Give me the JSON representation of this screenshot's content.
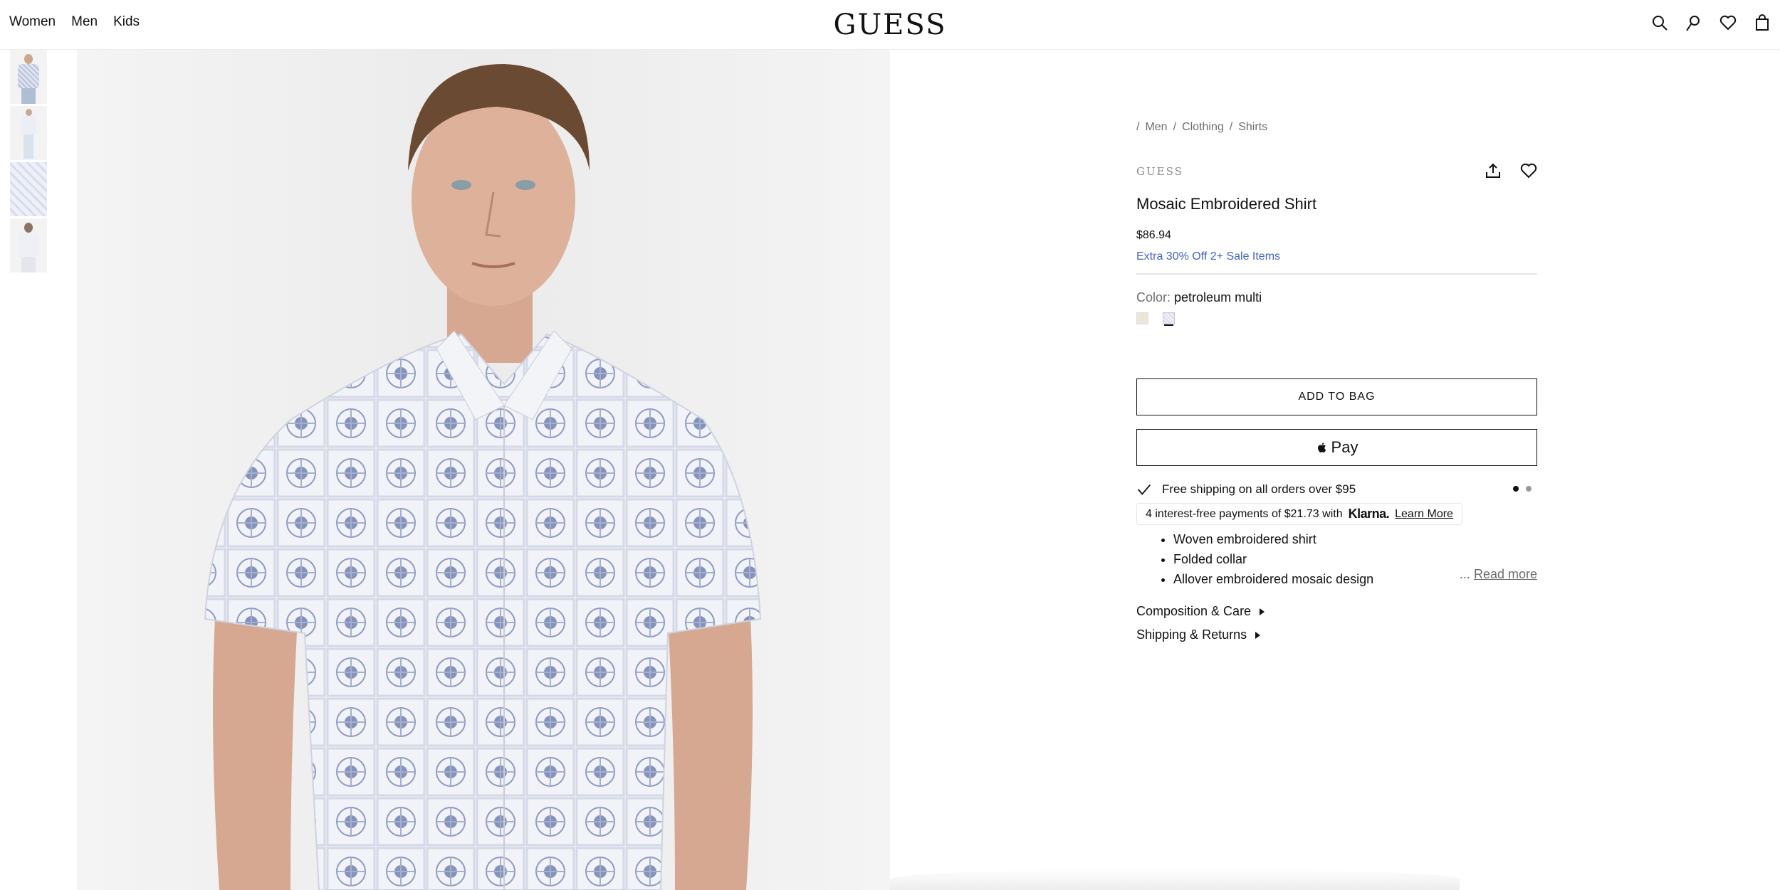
{
  "header": {
    "nav": [
      "Women",
      "Men",
      "Kids"
    ],
    "logo": "GUESS",
    "icons": [
      "search-icon",
      "account-icon",
      "wishlist-icon",
      "bag-icon"
    ]
  },
  "gallery": {
    "thumbnails": [
      "model-front",
      "model-full",
      "fabric-flat",
      "model-back"
    ],
    "main_image": "model wearing shirt"
  },
  "product": {
    "breadcrumb": [
      "Men",
      "Clothing",
      "Shirts"
    ],
    "brand": "GUESS",
    "title": "Mosaic Embroidered Shirt",
    "price": "$86.94",
    "promo": "Extra 30% Off 2+ Sale Items",
    "color_label": "Color:",
    "color_value": "petroleum multi",
    "add_to_bag": "ADD TO BAG",
    "apple_pay": "Pay",
    "shipping": "Free shipping on all orders over $95",
    "klarna": {
      "text": "4 interest-free payments of $21.73 with",
      "logo": "Klarna.",
      "link": "Learn More"
    },
    "features": [
      "Woven embroidered shirt",
      "Folded collar",
      "Allover embroidered mosaic design"
    ],
    "read_more_prefix": "...",
    "read_more": "Read more",
    "accordions": [
      "Composition & Care",
      "Shipping & Returns"
    ]
  },
  "colors": {
    "promo": "#3f63c4",
    "text": "#111111",
    "muted": "#6d6d6d"
  }
}
